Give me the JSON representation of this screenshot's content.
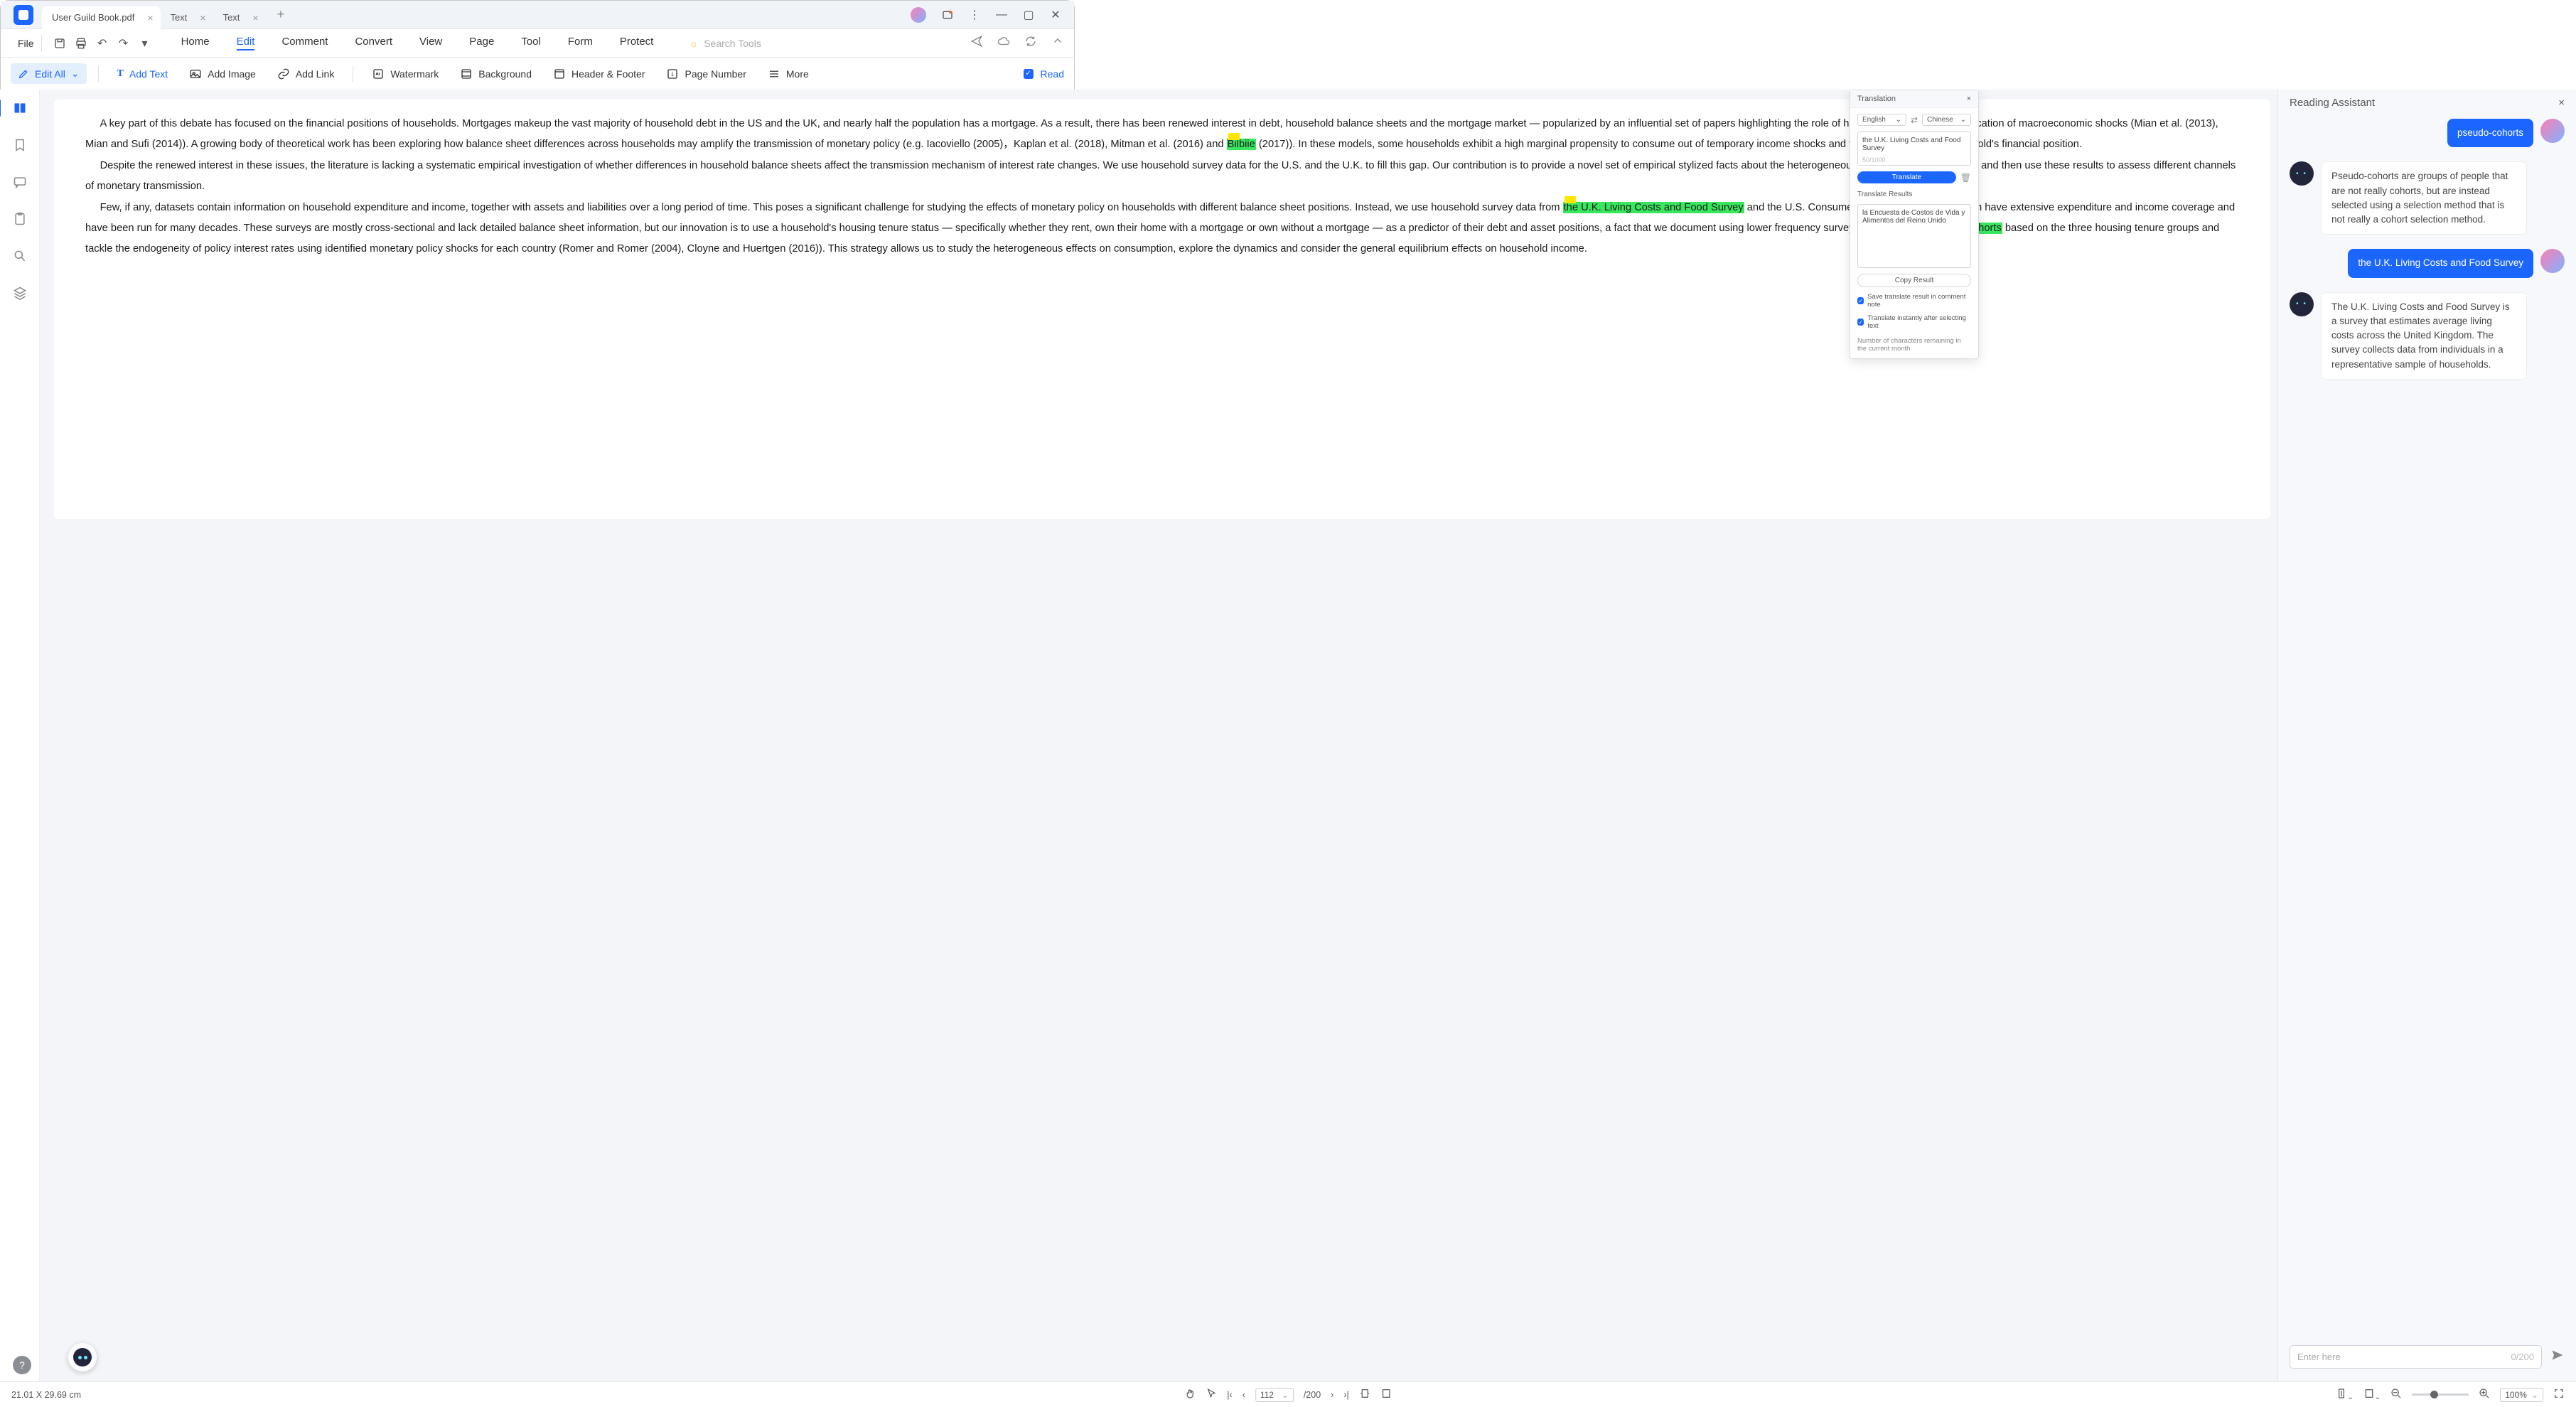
{
  "titlebar": {
    "tabs": [
      {
        "label": "User Guild Book.pdf",
        "active": true
      },
      {
        "label": "Text",
        "active": false
      },
      {
        "label": "Text",
        "active": false
      }
    ]
  },
  "menubar": {
    "file": "File",
    "items": [
      "Home",
      "Edit",
      "Comment",
      "Convert",
      "View",
      "Page",
      "Tool",
      "Form",
      "Protect"
    ],
    "active_index": 1,
    "search_placeholder": "Search Tools"
  },
  "toolbar": {
    "edit_all": "Edit All",
    "add_text": "Add Text",
    "add_image": "Add Image",
    "add_link": "Add Link",
    "watermark": "Watermark",
    "background": "Background",
    "header_footer": "Header & Footer",
    "page_number": "Page Number",
    "more": "More",
    "read": "Read"
  },
  "document": {
    "para1_a": "A key part of this debate has focused on the financial positions of households. Mortgages makeup the vast majority of household debt in the US and the UK, and nearly half the population has a mortgage. As a result, there has been renewed interest in debt, household balance sheets and the mortgage market — popularized by an influential set of papers highlighting the role of household debt in the amplification of macroeconomic shocks (Mian et al. (2013), Mian and Sufi (2014)). A growing body of theoretical work has been exploring how balance sheet differences across households may amplify the transmission of monetary policy (e.g. Iacoviello (2005)，Kaplan et al. (2018), Mitman et al. (2016) and ",
    "hl1": "Bilbiie",
    "para1_b": " (2017)). In these models, some households exhibit a high marginal propensity to consume out of temporary income shocks and this may vary with a household's financial position.",
    "para2": "Despite the renewed interest in these issues, the literature is lacking a systematic empirical investigation of whether differences in household balance sheets affect the transmission mechanism of interest rate changes. We use household survey data for the U.S. and the U.K. to fill this gap. Our contribution is to provide a novel set of empirical stylized facts about the heterogeneous effects of monetary policy and then use these results to assess different channels of monetary transmission.",
    "para3_a": "Few, if any, datasets contain information on household expenditure and income, together with assets and liabilities over a long period of time. This poses a significant challenge for studying the effects of monetary policy on households with different balance sheet positions. Instead, we use household survey data from ",
    "hl2": "the U.K. Living Costs and Food Survey",
    "para3_b": " and the U.S. Consumer Expenditure Survey, which have extensive expenditure and income coverage and have been run for many decades. These surveys are mostly cross-sectional and lack detailed balance sheet information, but our innovation is to use a household's housing tenure status — specifically whether they rent, own their home with a mortgage or own without a mortgage — as a predictor of their debt and asset positions, a fact that we document using lower frequency surveys. We construct ",
    "hl3": "pseudo-cohorts",
    "para3_c": " based on the three housing tenure groups and tackle the endogeneity of policy interest rates using identified monetary policy shocks for each country (Romer and Romer (2004), Cloyne and Huertgen (2016)). This strategy allows us to study the heterogeneous effects on consumption, explore the dynamics and consider the general equilibrium effects on household income."
  },
  "translation": {
    "title": "Translation",
    "lang_from": "English",
    "lang_to": "Chinese",
    "source_text": "the U.K. Living Costs and Food Survey",
    "char_count": "50/1000",
    "translate_btn": "Translate",
    "results_label": "Translate Results",
    "result_text": "la Encuesta de Costos de Vida y Alimentos del Reino Unido",
    "copy_btn": "Copy Result",
    "save_comment": "Save translate result in comment note",
    "instant": "Translate instantly after selecting text",
    "remaining": "Number of characters remaining in the current month"
  },
  "assistant": {
    "title": "Reading Assistant",
    "messages": [
      {
        "role": "user",
        "text": "pseudo-cohorts"
      },
      {
        "role": "bot",
        "text": "Pseudo-cohorts are groups of people that are not really cohorts, but are instead selected using a selection method that is not really a cohort selection method."
      },
      {
        "role": "user",
        "text": "the U.K. Living Costs and Food Survey"
      },
      {
        "role": "bot",
        "text": "The U.K. Living Costs and Food Survey is a survey that estimates average living costs across the United Kingdom. The survey collects data from individuals in a representative sample of households."
      }
    ],
    "input_placeholder": "Enter here",
    "input_count": "0/200"
  },
  "statusbar": {
    "dims": "21.01 X 29.69 cm",
    "page_current": "112",
    "page_total": "/200",
    "zoom": "100%"
  }
}
